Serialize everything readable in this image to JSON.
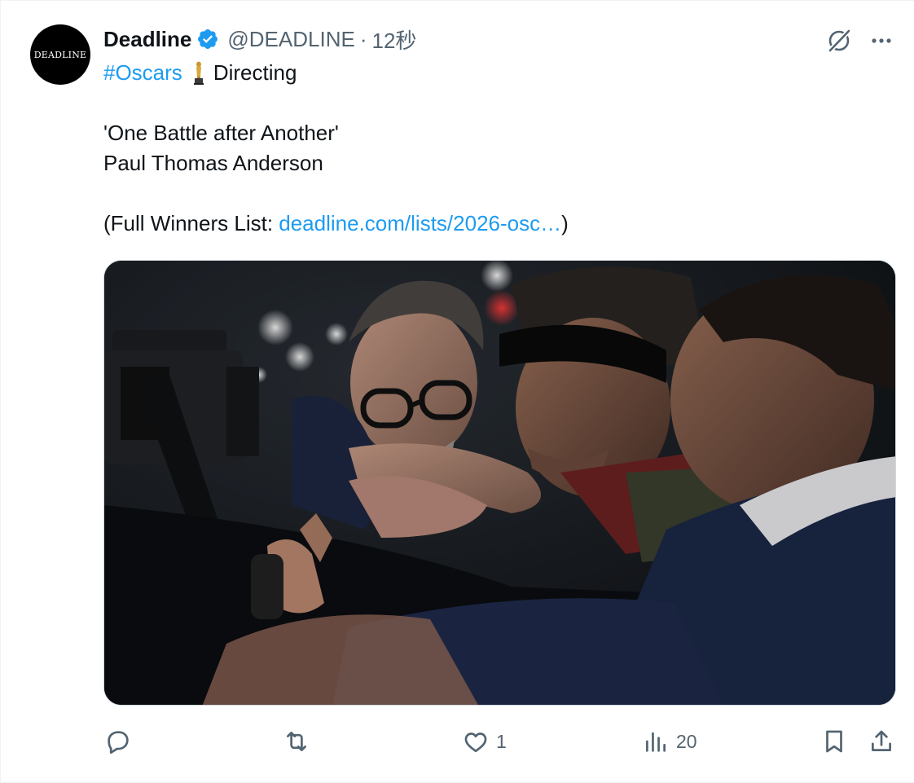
{
  "tweet": {
    "author": {
      "avatar_text": "DEADLINE",
      "display_name": "Deadline",
      "handle": "@DEADLINE",
      "separator": "·",
      "timestamp": "12秒",
      "verified": true
    },
    "text": {
      "hashtag": "#Oscars",
      "category": "Directing",
      "film": "'One Battle after Another'",
      "winner": "Paul Thomas Anderson",
      "list_prefix": "(Full Winners List: ",
      "list_link": "deadline.com/lists/2026-osc…",
      "list_suffix": ")"
    },
    "media": {
      "description": "Film still: director with glasses leaning on car window, two men in front seat at night"
    },
    "actions": {
      "reply_count": "",
      "retweet_count": "",
      "like_count": "1",
      "views_count": "20"
    }
  },
  "colors": {
    "accent": "#1d9bf0",
    "text": "#0f1419",
    "secondary": "#536471",
    "border": "#eff3f4"
  },
  "icons": {
    "verified": "verified-badge-icon",
    "grok": "grok-icon",
    "more": "more-dots-icon",
    "reply": "reply-icon",
    "retweet": "retweet-icon",
    "like": "heart-icon",
    "views": "views-icon",
    "bookmark": "bookmark-icon",
    "share": "share-icon",
    "trophy": "trophy-icon"
  }
}
